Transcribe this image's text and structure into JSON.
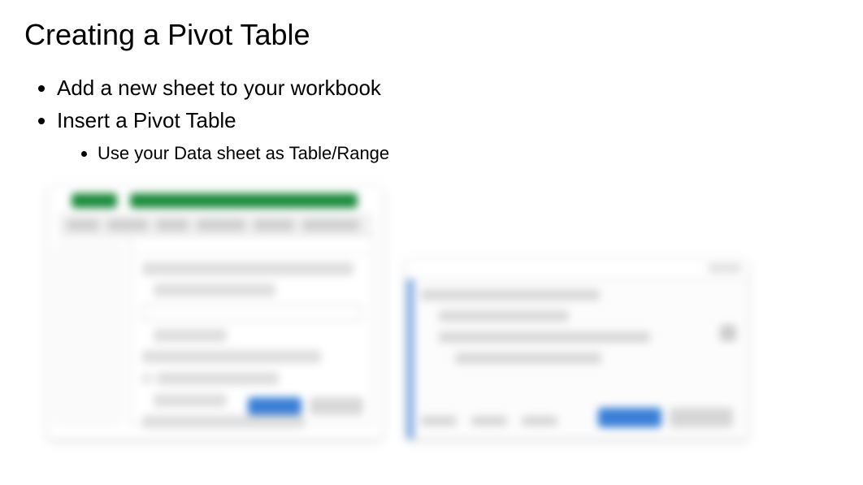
{
  "title": "Creating a Pivot Table",
  "bullets": {
    "b1": "Add a new sheet to your workbook",
    "b2": "Insert a Pivot Table",
    "b2_sub1": "Use your Data sheet as Table/Range"
  }
}
